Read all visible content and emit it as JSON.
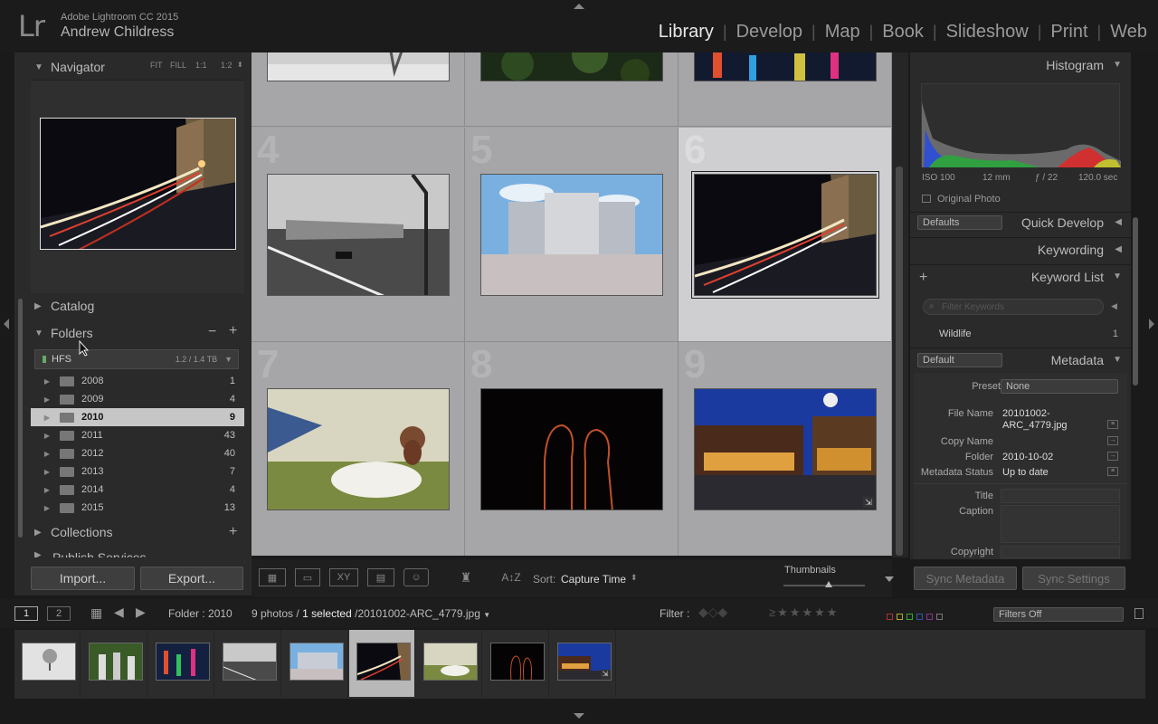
{
  "app": {
    "logo": "Lr",
    "name": "Adobe Lightroom CC 2015",
    "user": "Andrew Childress"
  },
  "modules": [
    "Library",
    "Develop",
    "Map",
    "Book",
    "Slideshow",
    "Print",
    "Web"
  ],
  "active_module": "Library",
  "navigator": {
    "title": "Navigator",
    "zoom": [
      "FIT",
      "FILL",
      "1:1",
      "1:2"
    ]
  },
  "catalog": {
    "title": "Catalog"
  },
  "folders": {
    "title": "Folders",
    "volume": {
      "name": "HFS",
      "size": "1.2 / 1.4 TB"
    },
    "items": [
      {
        "name": "2008",
        "count": "1"
      },
      {
        "name": "2009",
        "count": "4"
      },
      {
        "name": "2010",
        "count": "9",
        "selected": true
      },
      {
        "name": "2011",
        "count": "43"
      },
      {
        "name": "2012",
        "count": "40"
      },
      {
        "name": "2013",
        "count": "7"
      },
      {
        "name": "2014",
        "count": "4"
      },
      {
        "name": "2015",
        "count": "13"
      }
    ]
  },
  "collections": {
    "title": "Collections"
  },
  "publish_services": {
    "title": "Publish Services"
  },
  "buttons": {
    "import": "Import...",
    "export": "Export..."
  },
  "grid": {
    "rows": [
      {
        "indices": [
          "",
          "",
          ""
        ]
      },
      {
        "indices": [
          "4",
          "5",
          "6"
        ]
      },
      {
        "indices": [
          "7",
          "8",
          "9"
        ]
      }
    ],
    "selected_index": "6"
  },
  "toolbar": {
    "sort_label": "Sort:",
    "sort_value": "Capture Time",
    "thumbnails_label": "Thumbnails",
    "thumbnail_size": 0.55
  },
  "histogram": {
    "title": "Histogram",
    "iso": "ISO 100",
    "focal": "12 mm",
    "aperture": "ƒ / 22",
    "shutter": "120.0 sec",
    "original_photo": "Original Photo"
  },
  "quick_develop": {
    "title": "Quick Develop",
    "preset": "Defaults"
  },
  "keywording": {
    "title": "Keywording"
  },
  "keyword_list": {
    "title": "Keyword List",
    "filter_placeholder": "Filter Keywords",
    "items": [
      {
        "name": "Wildlife",
        "count": "1"
      }
    ]
  },
  "metadata": {
    "title": "Metadata",
    "preset_set": "Default",
    "preset_label": "Preset",
    "preset_value": "None",
    "fields": [
      {
        "label": "File Name",
        "value": "20101002-\nARC_4779.jpg"
      },
      {
        "label": "Copy Name",
        "value": ""
      },
      {
        "label": "Folder",
        "value": "2010-10-02"
      },
      {
        "label": "Metadata Status",
        "value": "Up to date"
      }
    ],
    "title_label": "Title",
    "caption_label": "Caption",
    "copyright_label": "Copyright"
  },
  "sync": {
    "metadata": "Sync Metadata",
    "settings": "Sync Settings"
  },
  "filmbar": {
    "page1": "1",
    "page2": "2",
    "source": "Folder : 2010",
    "count": "9 photos /",
    "selected": "1 selected",
    "file": "/20101002-ARC_4779.jpg",
    "filter_label": "Filter :",
    "filters_off": "Filters Off"
  },
  "colors": {
    "accent": "#e8e8e8",
    "panel": "#2a2a2a",
    "grid": "#a3a3a6",
    "selected_cell": "#cfcfd2"
  }
}
